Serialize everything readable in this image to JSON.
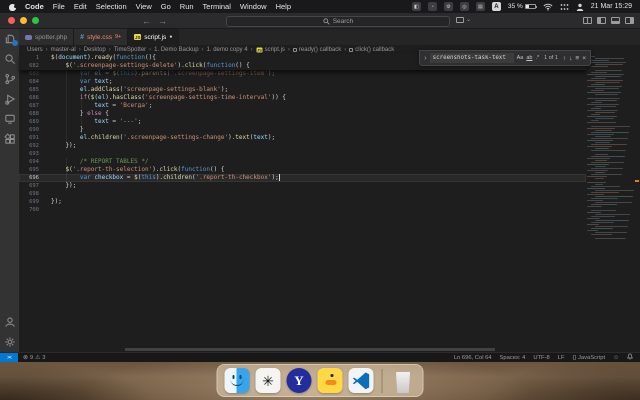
{
  "menubar": {
    "app_name": "Code",
    "menus": [
      "File",
      "Edit",
      "Selection",
      "View",
      "Go",
      "Run",
      "Terminal",
      "Window",
      "Help"
    ],
    "input_source": "A",
    "battery": "35 %",
    "clock": "21 Mar 15:29"
  },
  "titlebar": {
    "search_label": "Search"
  },
  "tabs": [
    {
      "name": "spotter.php",
      "icon": "php",
      "active": false,
      "modified": false,
      "badge": ""
    },
    {
      "name": "style.css",
      "icon": "css",
      "active": false,
      "modified": false,
      "badge": "9+"
    },
    {
      "name": "script.js",
      "icon": "js",
      "active": true,
      "modified": true,
      "badge": ""
    }
  ],
  "breadcrumbs": [
    {
      "label": "Users"
    },
    {
      "label": "master-al"
    },
    {
      "label": "Desktop"
    },
    {
      "label": "TimeSpotter"
    },
    {
      "label": "1. Demo Backup"
    },
    {
      "label": "1. demo copy 4"
    },
    {
      "label": "script.js",
      "icon": "js"
    },
    {
      "label": "ready() callback",
      "icon": "symbol"
    },
    {
      "label": "click() callback",
      "icon": "symbol"
    }
  ],
  "find_widget": {
    "query": "screenshots-task-text",
    "match_count": "1 of 1",
    "case_label": "Aa",
    "word_label": "ab",
    "regex_label": ".*"
  },
  "editor": {
    "sticky_lines": [
      {
        "n": "1",
        "t": [
          [
            "$",
            "fn"
          ],
          [
            "(",
            "pun"
          ],
          [
            "document",
            "vr"
          ],
          [
            ").",
            "pun"
          ],
          [
            "ready",
            "fn"
          ],
          [
            "(",
            "pun"
          ],
          [
            "function",
            "kw"
          ],
          [
            "(){",
            "pun"
          ]
        ]
      },
      {
        "n": "682",
        "t": [
          [
            "    ",
            "pun"
          ],
          [
            "$",
            "fn"
          ],
          [
            "(",
            "pun"
          ],
          [
            "'.screenpage-settings-delete'",
            "str"
          ],
          [
            ").",
            "pun"
          ],
          [
            "click",
            "fn"
          ],
          [
            "(",
            "pun"
          ],
          [
            "function",
            "kw"
          ],
          [
            "() {",
            "pun"
          ]
        ]
      }
    ],
    "lines": [
      {
        "n": "683",
        "dim": true,
        "t": [
          [
            "        ",
            "pun"
          ],
          [
            "var",
            "kw"
          ],
          [
            " ",
            "pun"
          ],
          [
            "el",
            "vr"
          ],
          [
            " = ",
            "pun"
          ],
          [
            "$",
            "fn"
          ],
          [
            "(",
            "pun"
          ],
          [
            "this",
            "kw"
          ],
          [
            ").",
            "pun"
          ],
          [
            "parents",
            "fn"
          ],
          [
            "(",
            "pun"
          ],
          [
            "'.screenpage-settings-item'",
            "str"
          ],
          [
            ");",
            "pun"
          ]
        ]
      },
      {
        "n": "684",
        "t": [
          [
            "        ",
            "pun"
          ],
          [
            "var",
            "kw"
          ],
          [
            " ",
            "pun"
          ],
          [
            "text",
            "vr"
          ],
          [
            ";",
            "pun"
          ]
        ]
      },
      {
        "n": "685",
        "t": [
          [
            "        ",
            "pun"
          ],
          [
            "el",
            "vr"
          ],
          [
            ".",
            "pun"
          ],
          [
            "addClass",
            "fn"
          ],
          [
            "(",
            "pun"
          ],
          [
            "'screenpage-settings-blank'",
            "str"
          ],
          [
            ");",
            "pun"
          ]
        ]
      },
      {
        "n": "686",
        "t": [
          [
            "        ",
            "pun"
          ],
          [
            "if",
            "ctrl"
          ],
          [
            "(",
            "pun"
          ],
          [
            "$",
            "fn"
          ],
          [
            "(",
            "pun"
          ],
          [
            "el",
            "vr"
          ],
          [
            ").",
            "pun"
          ],
          [
            "hasClass",
            "fn"
          ],
          [
            "(",
            "pun"
          ],
          [
            "'screenpage-settings-time-interval'",
            "str"
          ],
          [
            ")) {",
            "pun"
          ]
        ]
      },
      {
        "n": "687",
        "t": [
          [
            "            ",
            "pun"
          ],
          [
            "text",
            "vr"
          ],
          [
            " = ",
            "pun"
          ],
          [
            "'Всегда'",
            "str"
          ],
          [
            ";",
            "pun"
          ]
        ]
      },
      {
        "n": "688",
        "t": [
          [
            "        } ",
            "pun"
          ],
          [
            "else",
            "ctrl"
          ],
          [
            " {",
            "pun"
          ]
        ]
      },
      {
        "n": "689",
        "t": [
          [
            "            ",
            "pun"
          ],
          [
            "text",
            "vr"
          ],
          [
            " = ",
            "pun"
          ],
          [
            "'---'",
            "str"
          ],
          [
            ";",
            "pun"
          ]
        ]
      },
      {
        "n": "690",
        "t": [
          [
            "        }",
            "pun"
          ]
        ]
      },
      {
        "n": "691",
        "t": [
          [
            "        ",
            "pun"
          ],
          [
            "el",
            "vr"
          ],
          [
            ".",
            "pun"
          ],
          [
            "children",
            "fn"
          ],
          [
            "(",
            "pun"
          ],
          [
            "'.screenpage-settings-change'",
            "str"
          ],
          [
            ").",
            "pun"
          ],
          [
            "text",
            "fn"
          ],
          [
            "(",
            "pun"
          ],
          [
            "text",
            "vr"
          ],
          [
            ");",
            "pun"
          ]
        ]
      },
      {
        "n": "692",
        "t": [
          [
            "    });",
            "pun"
          ]
        ]
      },
      {
        "n": "693",
        "t": []
      },
      {
        "n": "694",
        "t": [
          [
            "        ",
            "pun"
          ],
          [
            "/* REPORT TABLES */",
            "cmt"
          ]
        ]
      },
      {
        "n": "695",
        "t": [
          [
            "    ",
            "pun"
          ],
          [
            "$",
            "fn"
          ],
          [
            "(",
            "pun"
          ],
          [
            "'.report-th-selection'",
            "str"
          ],
          [
            ").",
            "pun"
          ],
          [
            "click",
            "fn"
          ],
          [
            "(",
            "pun"
          ],
          [
            "function",
            "kw"
          ],
          [
            "() {",
            "pun"
          ]
        ]
      },
      {
        "n": "696",
        "current": true,
        "cursor": true,
        "t": [
          [
            "        ",
            "pun"
          ],
          [
            "var",
            "kw"
          ],
          [
            " ",
            "pun"
          ],
          [
            "checkbox",
            "vr"
          ],
          [
            " = ",
            "pun"
          ],
          [
            "$",
            "fn"
          ],
          [
            "(",
            "pun"
          ],
          [
            "this",
            "kw"
          ],
          [
            ").",
            "pun"
          ],
          [
            "children",
            "fn"
          ],
          [
            "(",
            "pun"
          ],
          [
            "'.report-th-checkbox'",
            "str"
          ],
          [
            ");",
            "pun"
          ]
        ]
      },
      {
        "n": "697",
        "t": [
          [
            "    });",
            "pun"
          ]
        ]
      },
      {
        "n": "698",
        "t": []
      },
      {
        "n": "699",
        "t": [
          [
            "});",
            "pun"
          ]
        ]
      },
      {
        "n": "700",
        "t": []
      }
    ]
  },
  "statusbar": {
    "remote_label": "><",
    "errors": "9",
    "warnings": "3",
    "cursor_position": "Ln 696, Col 64",
    "indentation": "Spaces: 4",
    "encoding": "UTF-8",
    "eol": "LF",
    "language": "JavaScript"
  },
  "dock": {
    "items": [
      "Finder",
      "ChatGPT",
      "Yandex Browser",
      "Cyberduck",
      "Visual Studio Code",
      "Trash"
    ]
  },
  "colors": {
    "accent_blue": "#0078d4",
    "tab_error_text": "#f48771",
    "string_orange": "#ce9178",
    "keyword_blue": "#569cd6",
    "control_purple": "#c586c0",
    "function_yellow": "#dcdcaa",
    "variable_blue": "#9cdcfe",
    "comment_green": "#6a9955",
    "find_match_marker": "#d18616"
  }
}
